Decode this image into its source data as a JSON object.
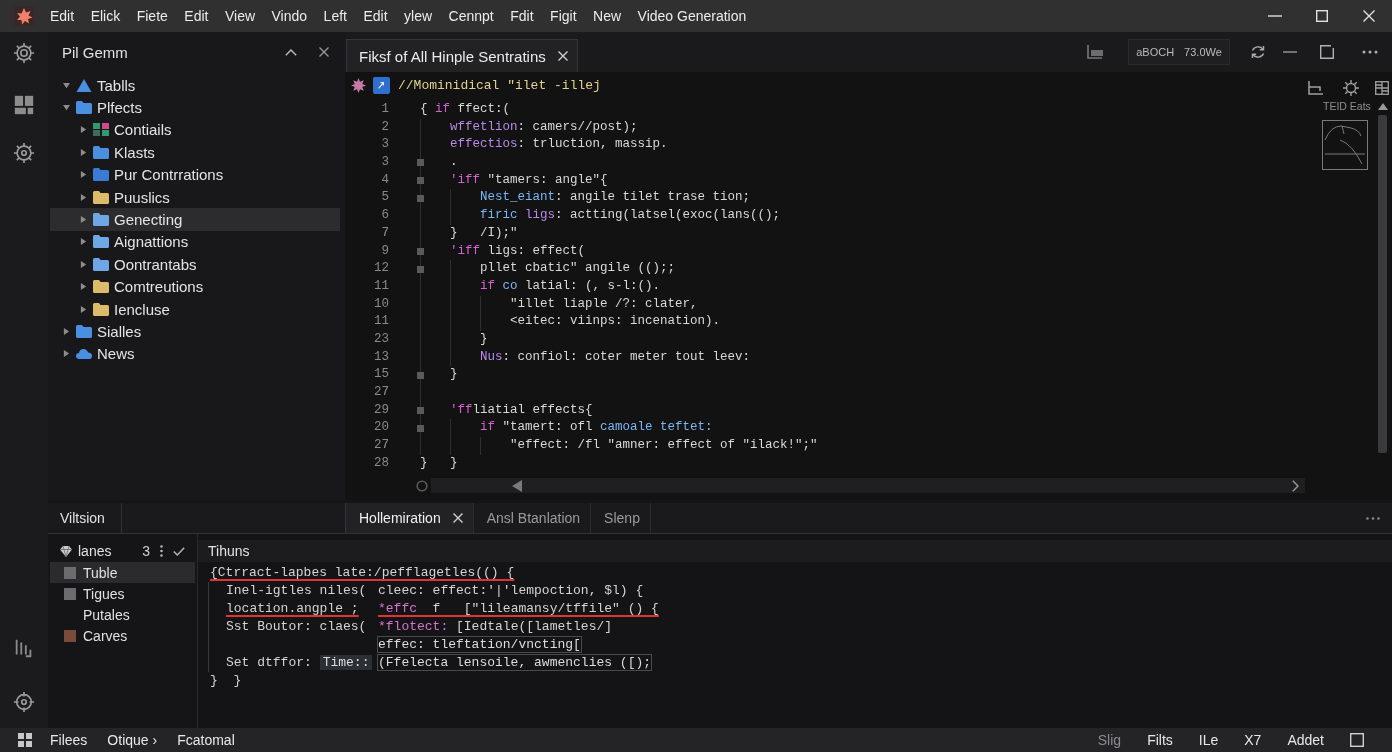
{
  "window": {
    "menu": [
      "Edit",
      "Elick",
      "Fiete",
      "Edit",
      "View",
      "Vindo",
      "Left",
      "Edit",
      "ylew",
      "Cennpt",
      "Fdit",
      "Figit",
      "New"
    ],
    "title": "Video Generation"
  },
  "sidebar": {
    "title": "Pil Gemm",
    "tree": [
      {
        "label": "Tablls",
        "kind": "alert",
        "color": "#4a8fe0",
        "expanded": true,
        "selected": false
      },
      {
        "label": "Plfects",
        "kind": "folder",
        "color": "#4a8fe0",
        "expanded": true,
        "selected": false,
        "children": [
          {
            "label": "Contiails",
            "kind": "grid",
            "color": "#2e9a6e",
            "expanded": false,
            "selected": false
          },
          {
            "label": "Klasts",
            "kind": "folder",
            "color": "#4a8fe0",
            "expanded": false,
            "selected": false
          },
          {
            "label": "Pur Contrrations",
            "kind": "folder",
            "color": "#3a7bd5",
            "expanded": false,
            "selected": false
          },
          {
            "label": "Puuslics",
            "kind": "folder",
            "color": "#dcbc6a",
            "expanded": false,
            "selected": false
          },
          {
            "label": "Genecting",
            "kind": "folder",
            "color": "#6fa7e6",
            "expanded": false,
            "selected": true
          },
          {
            "label": "Aignattions",
            "kind": "folder",
            "color": "#6fa7e6",
            "expanded": false,
            "selected": false
          },
          {
            "label": "Oontrantabs",
            "kind": "folder",
            "color": "#6fa7e6",
            "expanded": false,
            "selected": false
          },
          {
            "label": "Comtreutions",
            "kind": "folder",
            "color": "#dcbc6a",
            "expanded": false,
            "selected": false
          },
          {
            "label": "Iencluse",
            "kind": "folder",
            "color": "#dcbc6a",
            "expanded": false,
            "selected": false
          }
        ]
      },
      {
        "label": "Sialles",
        "kind": "folder",
        "color": "#4a8fe0",
        "expanded": false,
        "selected": false
      },
      {
        "label": "News",
        "kind": "cloud",
        "color": "#4a8fe0",
        "expanded": false,
        "selected": false
      }
    ]
  },
  "editor": {
    "tabs": [
      {
        "label": "Fiksf of All Hinple Sentratins",
        "selected": true
      }
    ],
    "toolbar_readouts": [
      "aBOCH",
      "73.0We"
    ],
    "breadcrumb": "//Mominidical \"ilet -illej",
    "lines": [
      {
        "number": "1",
        "fold_marker": false,
        "tokens": [
          {
            "kind": "plain",
            "text": "{ "
          },
          {
            "kind": "keyword",
            "text": "if"
          },
          {
            "kind": "plain",
            "text": " ffect:("
          }
        ],
        "children": [
          {
            "number": "2",
            "fold_marker": false,
            "tokens": [
              {
                "kind": "property",
                "text": "wffetlion"
              },
              {
                "kind": "plain",
                "text": ": camers//post);"
              }
            ]
          },
          {
            "number": "3",
            "fold_marker": false,
            "tokens": [
              {
                "kind": "property",
                "text": "effectios"
              },
              {
                "kind": "plain",
                "text": ": trluction, massip."
              }
            ]
          },
          {
            "number": "3",
            "fold_marker": true,
            "tokens": [
              {
                "kind": "plain",
                "text": "."
              }
            ]
          },
          {
            "number": "4",
            "fold_marker": true,
            "tokens": [
              {
                "kind": "keyword",
                "text": "'iff"
              },
              {
                "kind": "plain",
                "text": " \"tamers: angle\"{"
              }
            ],
            "children": [
              {
                "number": "5",
                "fold_marker": true,
                "tokens": [
                  {
                    "kind": "type",
                    "text": "Nest_eiant"
                  },
                  {
                    "kind": "plain",
                    "text": ": angile tilet trase tion;"
                  }
                ]
              },
              {
                "number": "6",
                "fold_marker": false,
                "tokens": [
                  {
                    "kind": "type",
                    "text": "firic "
                  },
                  {
                    "kind": "property",
                    "text": "ligs"
                  },
                  {
                    "kind": "plain",
                    "text": ": actting(latsel(exoc(lans(();"
                  }
                ]
              }
            ]
          },
          {
            "number": "7",
            "fold_marker": false,
            "tokens": [
              {
                "kind": "plain",
                "text": "}   /I);\""
              }
            ]
          },
          {
            "number": "9",
            "fold_marker": true,
            "tokens": [
              {
                "kind": "keyword",
                "text": "'iff"
              },
              {
                "kind": "plain",
                "text": " ligs: effect("
              }
            ],
            "children": [
              {
                "number": "12",
                "fold_marker": true,
                "tokens": [
                  {
                    "kind": "plain",
                    "text": "pllet cbatic\" angile (();;"
                  }
                ]
              },
              {
                "number": "11",
                "fold_marker": false,
                "tokens": [
                  {
                    "kind": "keyword",
                    "text": "if"
                  },
                  {
                    "kind": "type",
                    "text": " co"
                  },
                  {
                    "kind": "plain",
                    "text": " latial: (, s-l:()."
                  }
                ],
                "children": [
                  {
                    "number": "10",
                    "fold_marker": false,
                    "tokens": [
                      {
                        "kind": "plain",
                        "text": "\"illet liaple /?: clater,"
                      }
                    ]
                  },
                  {
                    "number": "11",
                    "fold_marker": false,
                    "tokens": [
                      {
                        "kind": "plain",
                        "text": "<eitec: viinps: incenation)."
                      }
                    ]
                  }
                ]
              },
              {
                "number": "23",
                "fold_marker": false,
                "tokens": [
                  {
                    "kind": "plain",
                    "text": "}"
                  }
                ]
              },
              {
                "number": "13",
                "fold_marker": false,
                "tokens": [
                  {
                    "kind": "property",
                    "text": "Nus"
                  },
                  {
                    "kind": "plain",
                    "text": ": confiol: coter meter tout leev:"
                  }
                ]
              }
            ]
          },
          {
            "number": "15",
            "fold_marker": true,
            "tokens": [
              {
                "kind": "plain",
                "text": "}"
              }
            ]
          },
          {
            "number": "27",
            "fold_marker": false
          },
          {
            "number": "29",
            "fold_marker": true,
            "tokens": [
              {
                "kind": "keyword",
                "text": "'ff"
              },
              {
                "kind": "plain",
                "text": "liatial effects{"
              }
            ],
            "children": [
              {
                "number": "20",
                "fold_marker": true,
                "tokens": [
                  {
                    "kind": "keyword",
                    "text": "if"
                  },
                  {
                    "kind": "plain",
                    "text": " \"tamert: ofl "
                  },
                  {
                    "kind": "type",
                    "text": "camoale teftet:"
                  }
                ],
                "children": [
                  {
                    "number": "27",
                    "fold_marker": false,
                    "tokens": [
                      {
                        "kind": "plain",
                        "text": "\"effect: /fl \"amner: effect of \"ilack!\";\""
                      }
                    ]
                  }
                ]
              }
            ]
          }
        ]
      },
      {
        "number": "28",
        "fold_marker": false,
        "tokens": [
          {
            "kind": "plain",
            "text": "}   }"
          }
        ]
      }
    ],
    "minimap_label": "TEID Eats"
  },
  "panel": {
    "title": "Viltsion",
    "tabs": [
      {
        "label": "Hollemiration",
        "selected": true
      },
      {
        "label": "Ansl Btanlation",
        "selected": false
      },
      {
        "label": "Slenp",
        "selected": false
      }
    ],
    "list": {
      "title": "lanes",
      "count": "3",
      "items": [
        {
          "label": "Tuble",
          "selected": true,
          "color": "#6b6b70"
        },
        {
          "label": "Tigues",
          "selected": false,
          "color": "#6b6b70"
        },
        {
          "label": "Putales",
          "selected": false
        },
        {
          "label": "Carves",
          "selected": false,
          "color": "#7a4a3a"
        }
      ]
    },
    "output": {
      "title": "Tihuns",
      "lines": [
        {
          "error": true,
          "head": [
            {
              "kind": "plain",
              "text": "{Ctrract-lapbes late:/pefflagetles(() {"
            }
          ],
          "children": [
            {
              "error": false,
              "head": [
                {
                  "kind": "plain",
                  "text": "Inel-igtles niles("
                }
              ],
              "body": [
                {
                  "kind": "plain",
                  "text": "cleec: effect:'|'lempoction, $l) {"
                }
              ]
            },
            {
              "error": true,
              "head": [
                {
                  "kind": "plain",
                  "text": "location.angple ;"
                }
              ],
              "body": [
                {
                  "kind": "keyword",
                  "text": "*effc"
                },
                {
                  "kind": "plain",
                  "text": "  f   [\"lileamansy/tffile\" () {"
                }
              ]
            },
            {
              "error": false,
              "head": [
                {
                  "kind": "plain",
                  "text": "Sst Boutor: claes("
                }
              ],
              "body": [
                {
                  "kind": "keyword",
                  "text": "*flotect:"
                },
                {
                  "kind": "plain",
                  "text": " [Iedtale([lametles/]"
                }
              ]
            },
            {
              "error": false,
              "body": [
                {
                  "kind": "boxed",
                  "text": "effec: tleftation/vncting["
                }
              ]
            },
            {
              "error": false,
              "head": [
                {
                  "kind": "plain",
                  "text": "Set dtffor: "
                },
                {
                  "kind": "hint",
                  "text": "Time::"
                }
              ],
              "body": [
                {
                  "kind": "boxed",
                  "text": "(Ffelecta lensoile, awmenclies ([);"
                }
              ]
            }
          ]
        },
        {
          "error": false,
          "head": [
            {
              "kind": "plain",
              "text": "}  }"
            }
          ]
        }
      ]
    }
  },
  "status_bar": {
    "left": [
      "Filees",
      "Otique ›",
      "Fcatomal"
    ],
    "right": [
      {
        "label": "Slig",
        "disabled": true
      },
      {
        "label": "Filts",
        "disabled": false
      },
      {
        "label": "ILe",
        "disabled": false
      },
      {
        "label": "X7",
        "disabled": false
      },
      {
        "label": "Addet",
        "disabled": false
      }
    ]
  }
}
